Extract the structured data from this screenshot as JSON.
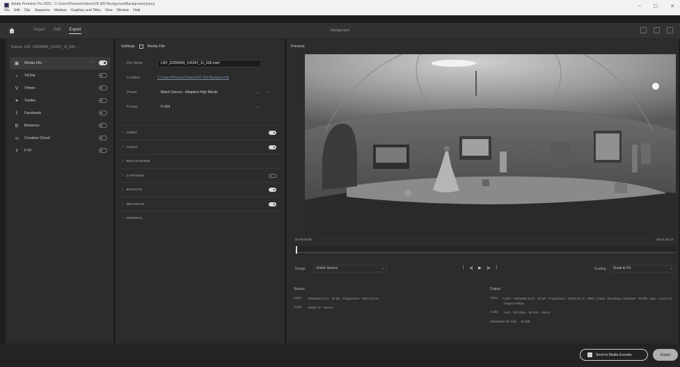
{
  "window": {
    "title": "Adobe Premiere Pro 2022 - C:\\Users\\Phoenix\\Videos\\VR 360 Background\\Background.prproj",
    "menu": [
      "File",
      "Edit",
      "Clip",
      "Sequence",
      "Markers",
      "Graphics and Titles",
      "View",
      "Window",
      "Help"
    ],
    "controls": [
      "–",
      "☐",
      "✕"
    ]
  },
  "workspace": {
    "tabs": [
      {
        "label": "Import",
        "active": false
      },
      {
        "label": "Edit",
        "active": false
      },
      {
        "label": "Export",
        "active": true
      }
    ],
    "project_name": "Background"
  },
  "source": {
    "label": "Source: LRV_20200904_141947_11_036 ···"
  },
  "destinations": [
    {
      "icon": "media-file-icon",
      "glyph": "▣",
      "label": "Media File",
      "on": true,
      "selected": true
    },
    {
      "icon": "tiktok-icon",
      "glyph": "♪",
      "label": "TikTok",
      "on": false,
      "selected": false
    },
    {
      "icon": "vimeo-icon",
      "glyph": "V",
      "label": "Vimeo",
      "on": false,
      "selected": false
    },
    {
      "icon": "twitter-icon",
      "glyph": "✦",
      "label": "Twitter",
      "on": false,
      "selected": false
    },
    {
      "icon": "facebook-icon",
      "glyph": "f",
      "label": "Facebook",
      "on": false,
      "selected": false
    },
    {
      "icon": "behance-icon",
      "glyph": "B",
      "label": "Behance",
      "on": false,
      "selected": false
    },
    {
      "icon": "creative-cloud-icon",
      "glyph": "∞",
      "label": "Creative Cloud",
      "on": false,
      "selected": false
    },
    {
      "icon": "ftp-icon",
      "glyph": "⇪",
      "label": "FTP",
      "on": false,
      "selected": false
    }
  ],
  "settings": {
    "header": "Settings",
    "media_file_label": "Media File",
    "file_name_label": "File Name",
    "file_name_value": "LRV_20200904_141947_11_036.mp4",
    "location_label": "Location",
    "location_value": "C:\\Users\\Phoenix\\Videos\\VR 360 Background\\",
    "preset_label": "Preset",
    "preset_value": "Match Source - Adaptive High Bitrate",
    "format_label": "Format",
    "format_value": "H.264",
    "sections": [
      {
        "label": "VIDEO",
        "toggle": true
      },
      {
        "label": "AUDIO",
        "toggle": true
      },
      {
        "label": "MULTIPLEXER",
        "toggle": null
      },
      {
        "label": "CAPTIONS",
        "toggle": false
      },
      {
        "label": "EFFECTS",
        "toggle": true
      },
      {
        "label": "METADATA",
        "toggle": true
      },
      {
        "label": "GENERAL",
        "toggle": null
      }
    ]
  },
  "preview": {
    "label": "Preview",
    "timecode_start": "00;00;00;00",
    "timecode_end": "00;01;28;13",
    "range_label": "Range",
    "range_value": "Entire Source",
    "scaling_label": "Scaling",
    "scaling_value": "Scale to Fit"
  },
  "source_info": {
    "title": "Source",
    "video_label": "Video",
    "video_value": "1920x960 (2.0) · 30 fps · Progressive · 00;01;28;13",
    "audio_label": "Audio",
    "audio_value": "48000 Hz · Stereo"
  },
  "output_info": {
    "title": "Output",
    "video_label": "Video",
    "video_value": "H.264 · 1920x960 (2.0) · 30 fps · Progressive · 00;01;28;13 · VBR, 1 pass · Encoding: Hardware · Profile: High · Level: 5.1 · Target 8 Mbps",
    "audio_label": "Audio",
    "audio_value": "AAC · 320 kbps · 48 kHz · Stereo",
    "size_label": "Estimated File Size",
    "size_value": "90 MB"
  },
  "footer": {
    "ame_label": "Send to Media Encoder",
    "export_label": "Export"
  }
}
